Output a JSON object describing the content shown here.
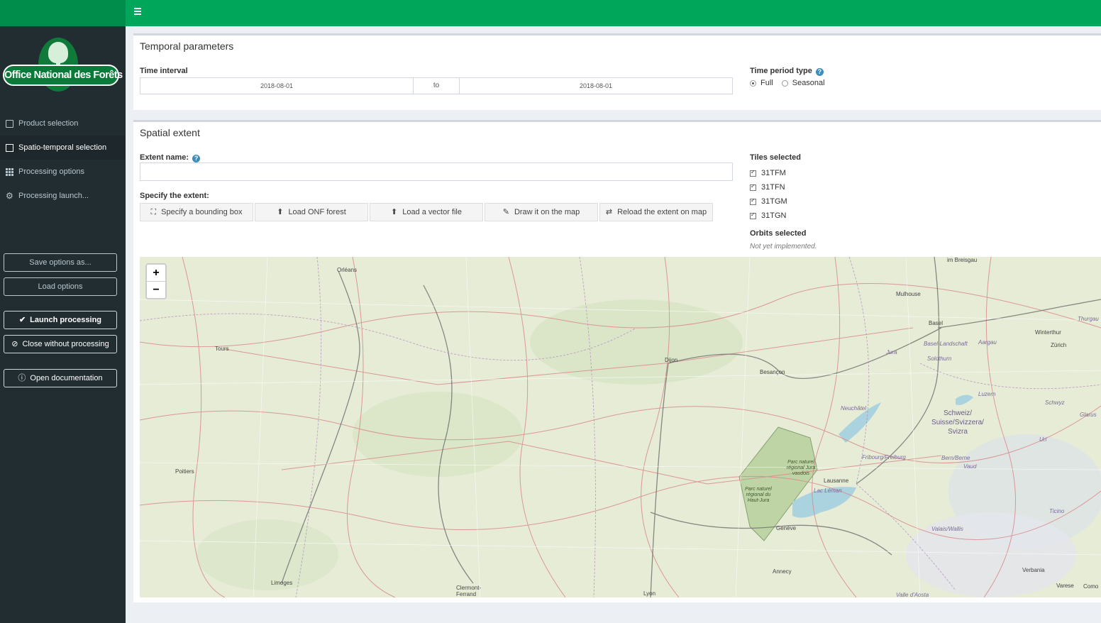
{
  "brand": {
    "name": "Office National des Forêts"
  },
  "sidebar": {
    "items": [
      {
        "label": "Product selection",
        "icon": "image-icon"
      },
      {
        "label": "Spatio-temporal selection",
        "icon": "copy-icon",
        "active": true
      },
      {
        "label": "Processing options",
        "icon": "grid-icon"
      },
      {
        "label": "Processing launch...",
        "icon": "gear-icon"
      }
    ],
    "buttons": {
      "save": "Save options as...",
      "load": "Load options",
      "launch": "Launch processing",
      "close": "Close without processing",
      "doc": "Open documentation"
    }
  },
  "temporal": {
    "title": "Temporal parameters",
    "interval_label": "Time interval",
    "start": "2018-08-01",
    "to": "to",
    "end": "2018-08-01",
    "period_label": "Time period type",
    "options": [
      "Full",
      "Seasonal"
    ],
    "selected": "Full"
  },
  "spatial": {
    "title": "Spatial extent",
    "extent_name_label": "Extent name:",
    "extent_name_value": "",
    "specify_label": "Specify the extent:",
    "buttons": [
      "Specify a bounding box",
      "Load ONF forest",
      "Load a vector file",
      "Draw it on the map",
      "Reload the extent on map"
    ],
    "tiles_label": "Tiles selected",
    "tiles": [
      "31TFM",
      "31TFN",
      "31TGM",
      "31TGN"
    ],
    "orbits_label": "Orbits selected",
    "orbits_value": "Not yet implemented."
  },
  "map": {
    "zoom_in": "+",
    "zoom_out": "−",
    "cities": [
      "Orléans",
      "Tours",
      "Poitiers",
      "Limoges",
      "Clermont-Ferrand",
      "Lyon",
      "Dijon",
      "Besançon",
      "Mulhouse",
      "Basel",
      "Winterthur",
      "Zürich",
      "Lausanne",
      "Genève",
      "Annecy",
      "Verbania",
      "Varese",
      "Como",
      "im Breisgau"
    ],
    "regions": [
      "Basel-Landschaft",
      "Aargau",
      "Solothurn",
      "Jura",
      "Luzern",
      "Neuchâtel",
      "Schwyz",
      "Glarus",
      "Fribourg/Freiburg",
      "Bern/Berne",
      "Vaud",
      "Lac Léman",
      "Valais/Wallis",
      "Ticino",
      "Thurgau",
      "Valle d'Aosta",
      "Uri"
    ],
    "country": "Schweiz/ Suisse/Svizzera/ Svizra",
    "parks": [
      "Parc naturel régional du Haut-Jura",
      "Parc naturel régional Jura vaudois"
    ]
  },
  "colors": {
    "header": "#00a65a",
    "sidebar": "#222d32",
    "accent": "#3c8dbc"
  }
}
